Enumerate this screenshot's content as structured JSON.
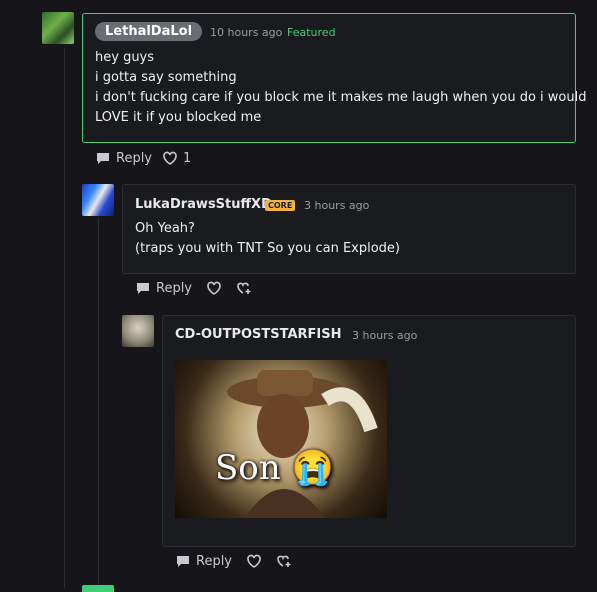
{
  "comments": [
    {
      "username": "LethalDaLol",
      "time": "10 hours ago",
      "badge": "Featured",
      "lines": [
        "hey guys",
        "i gotta say something",
        "i don't fucking care if you block me it makes me laugh when you do i would",
        "LOVE it if you blocked me"
      ],
      "reply_label": "Reply",
      "like_count": "1"
    },
    {
      "username": "LukaDrawsStuffXD",
      "core_badge": "CORE",
      "time": "3 hours ago",
      "lines": [
        "Oh Yeah?",
        "(traps you with TNT So you can Explode)"
      ],
      "reply_label": "Reply"
    },
    {
      "username": "CD-OUTPOSTSTARFISH",
      "time": "3 hours ago",
      "gif_caption": "Son 😭",
      "reply_label": "Reply"
    }
  ],
  "colors": {
    "background": "#16161a",
    "card": "#1a1b1f",
    "featured_accent": "#3fcf7a",
    "core_badge": "#f4b23d"
  }
}
